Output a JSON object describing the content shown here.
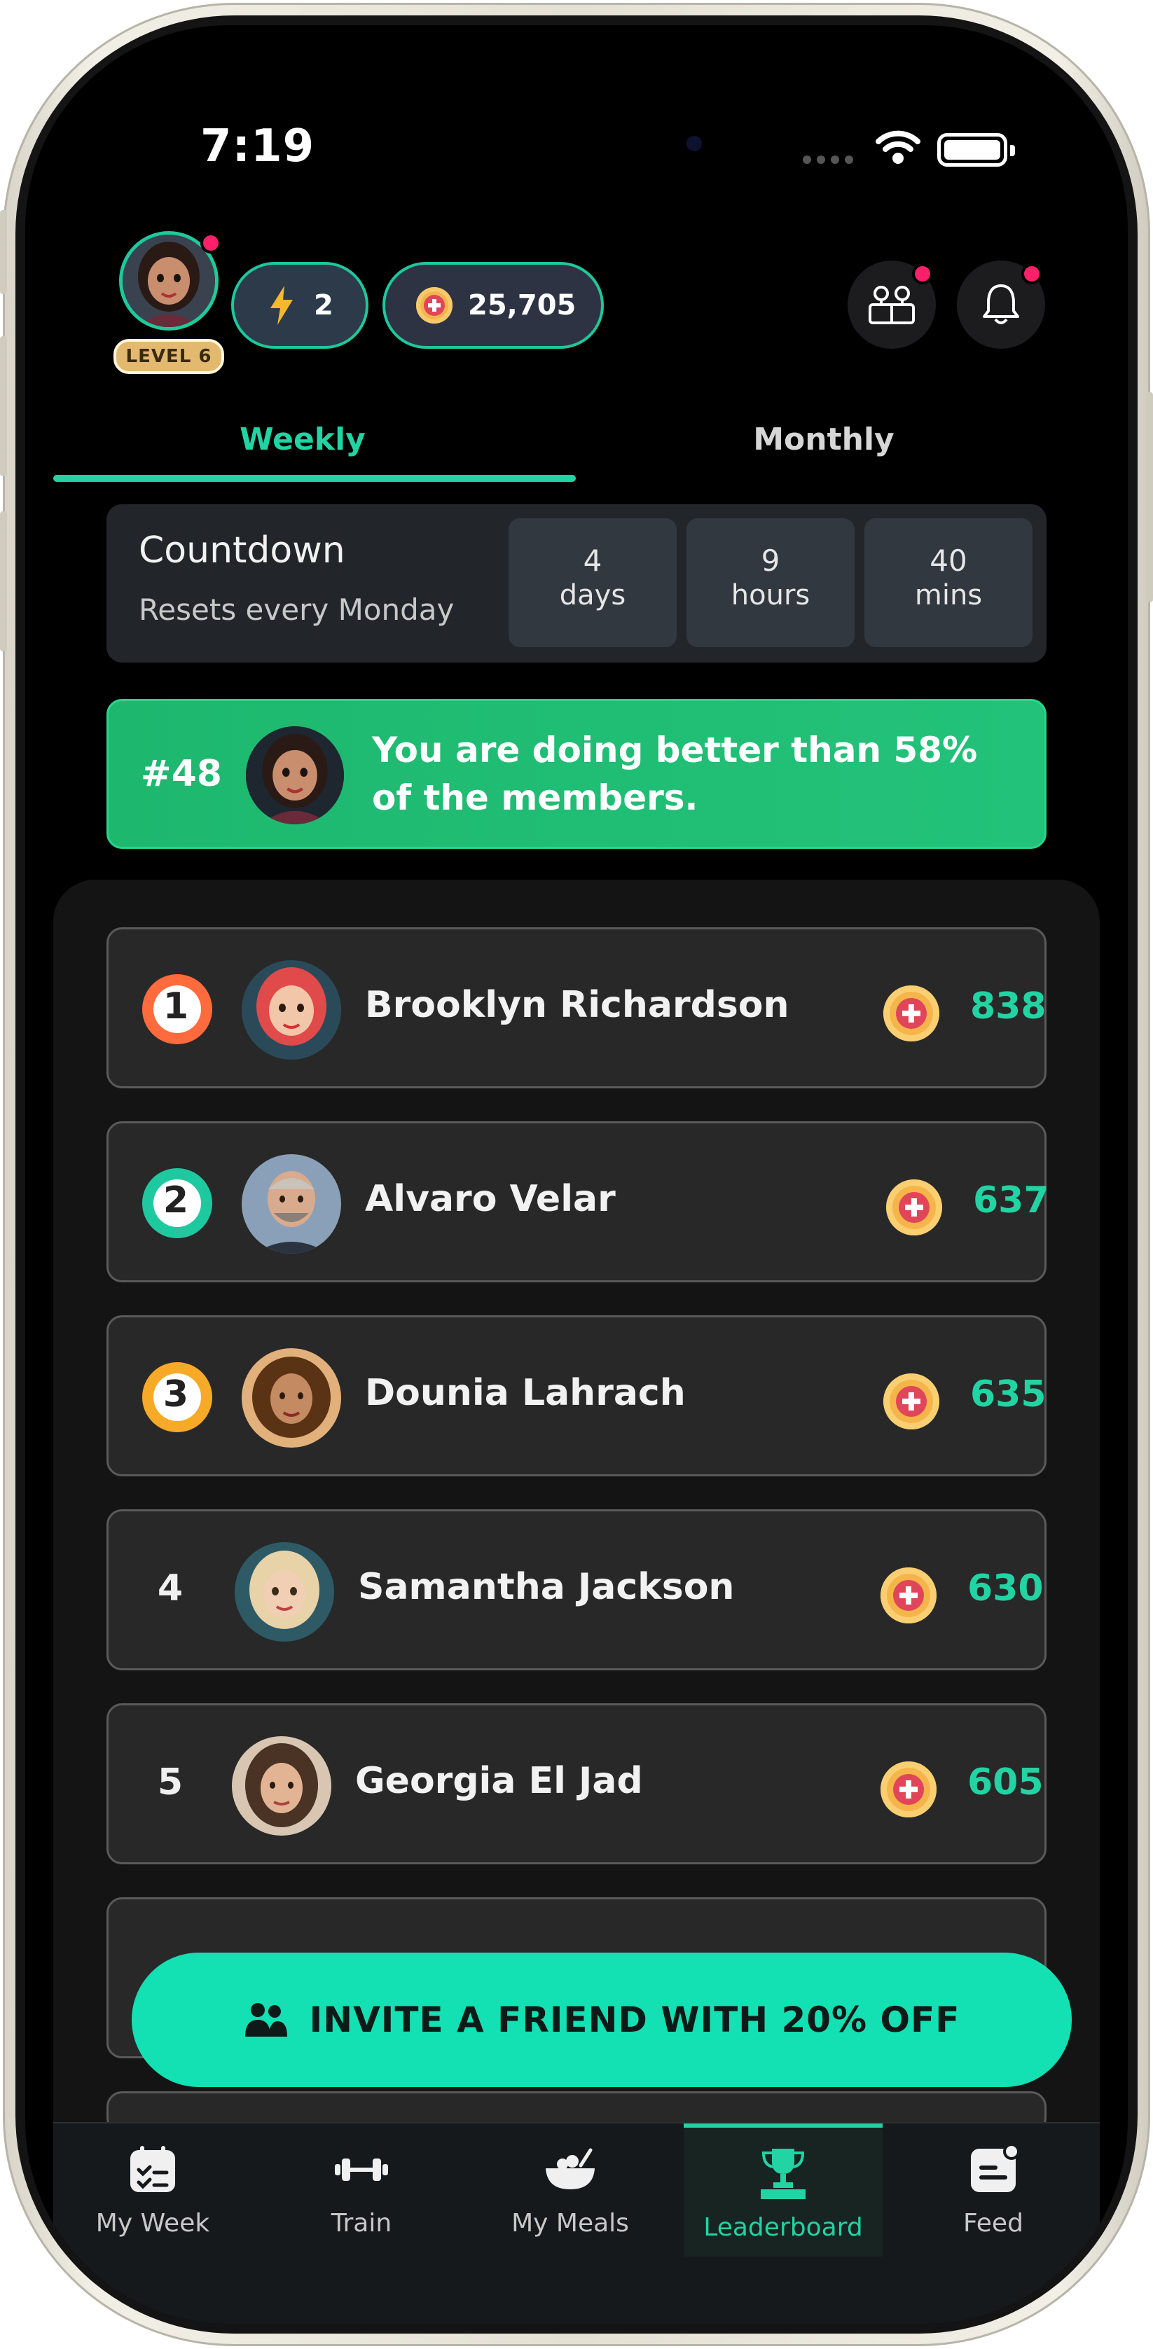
{
  "status_bar": {
    "time": "7:19"
  },
  "header": {
    "level": "LEVEL 6",
    "energy": "2",
    "coins": "25,705"
  },
  "tabs": [
    {
      "label": "Weekly",
      "active": true
    },
    {
      "label": "Monthly",
      "active": false
    }
  ],
  "countdown": {
    "title": "Countdown",
    "subtitle": "Resets every Monday",
    "units": [
      {
        "value": "4",
        "unit": "days"
      },
      {
        "value": "9",
        "unit": "hours"
      },
      {
        "value": "40",
        "unit": "mins"
      }
    ]
  },
  "rank": {
    "position": "#48",
    "message": "You are doing better than 58% of the members."
  },
  "leaderboard": [
    {
      "rank": "1",
      "name": "Brooklyn Richardson",
      "score": "838",
      "badge_color": "#ff6b3d"
    },
    {
      "rank": "2",
      "name": "Alvaro Velar",
      "score": "637",
      "badge_color": "#1fc9a0"
    },
    {
      "rank": "3",
      "name": "Dounia Lahrach",
      "score": "635",
      "badge_color": "#f7a928"
    },
    {
      "rank": "4",
      "name": "Samantha Jackson",
      "score": "630"
    },
    {
      "rank": "5",
      "name": "Georgia El Jad",
      "score": "605"
    }
  ],
  "invite_button": "INVITE A FRIEND WITH 20% OFF",
  "bottom_nav": [
    {
      "label": "My Week",
      "icon": "calendar-check-icon"
    },
    {
      "label": "Train",
      "icon": "dumbbell-icon"
    },
    {
      "label": "My Meals",
      "icon": "bowl-icon"
    },
    {
      "label": "Leaderboard",
      "icon": "trophy-icon",
      "active": true
    },
    {
      "label": "Feed",
      "icon": "feed-icon"
    }
  ],
  "colors": {
    "accent": "#22d3a3",
    "invite": "#13e0b3",
    "banner": "#1db86e",
    "notification_dot": "#ff1f6b"
  }
}
